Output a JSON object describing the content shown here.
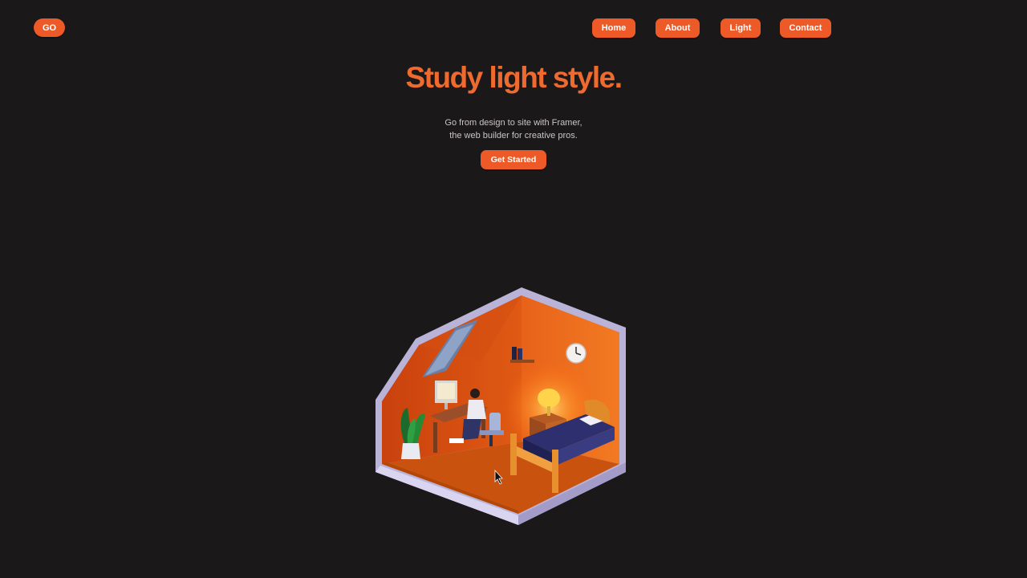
{
  "header": {
    "logo_label": "GO",
    "nav": {
      "home": "Home",
      "about": "About",
      "light": "Light",
      "contact": "Contact"
    }
  },
  "hero": {
    "title": "Study light style.",
    "subtitle_line1": "Go from design to site with Framer,",
    "subtitle_line2": "the web builder for creative pros.",
    "cta_label": "Get Started"
  },
  "illustration": {
    "name": "isometric-bedroom-study-scene"
  },
  "colors": {
    "background": "#1a1819",
    "accent": "#ee5a27",
    "title": "#ee6a2f"
  }
}
